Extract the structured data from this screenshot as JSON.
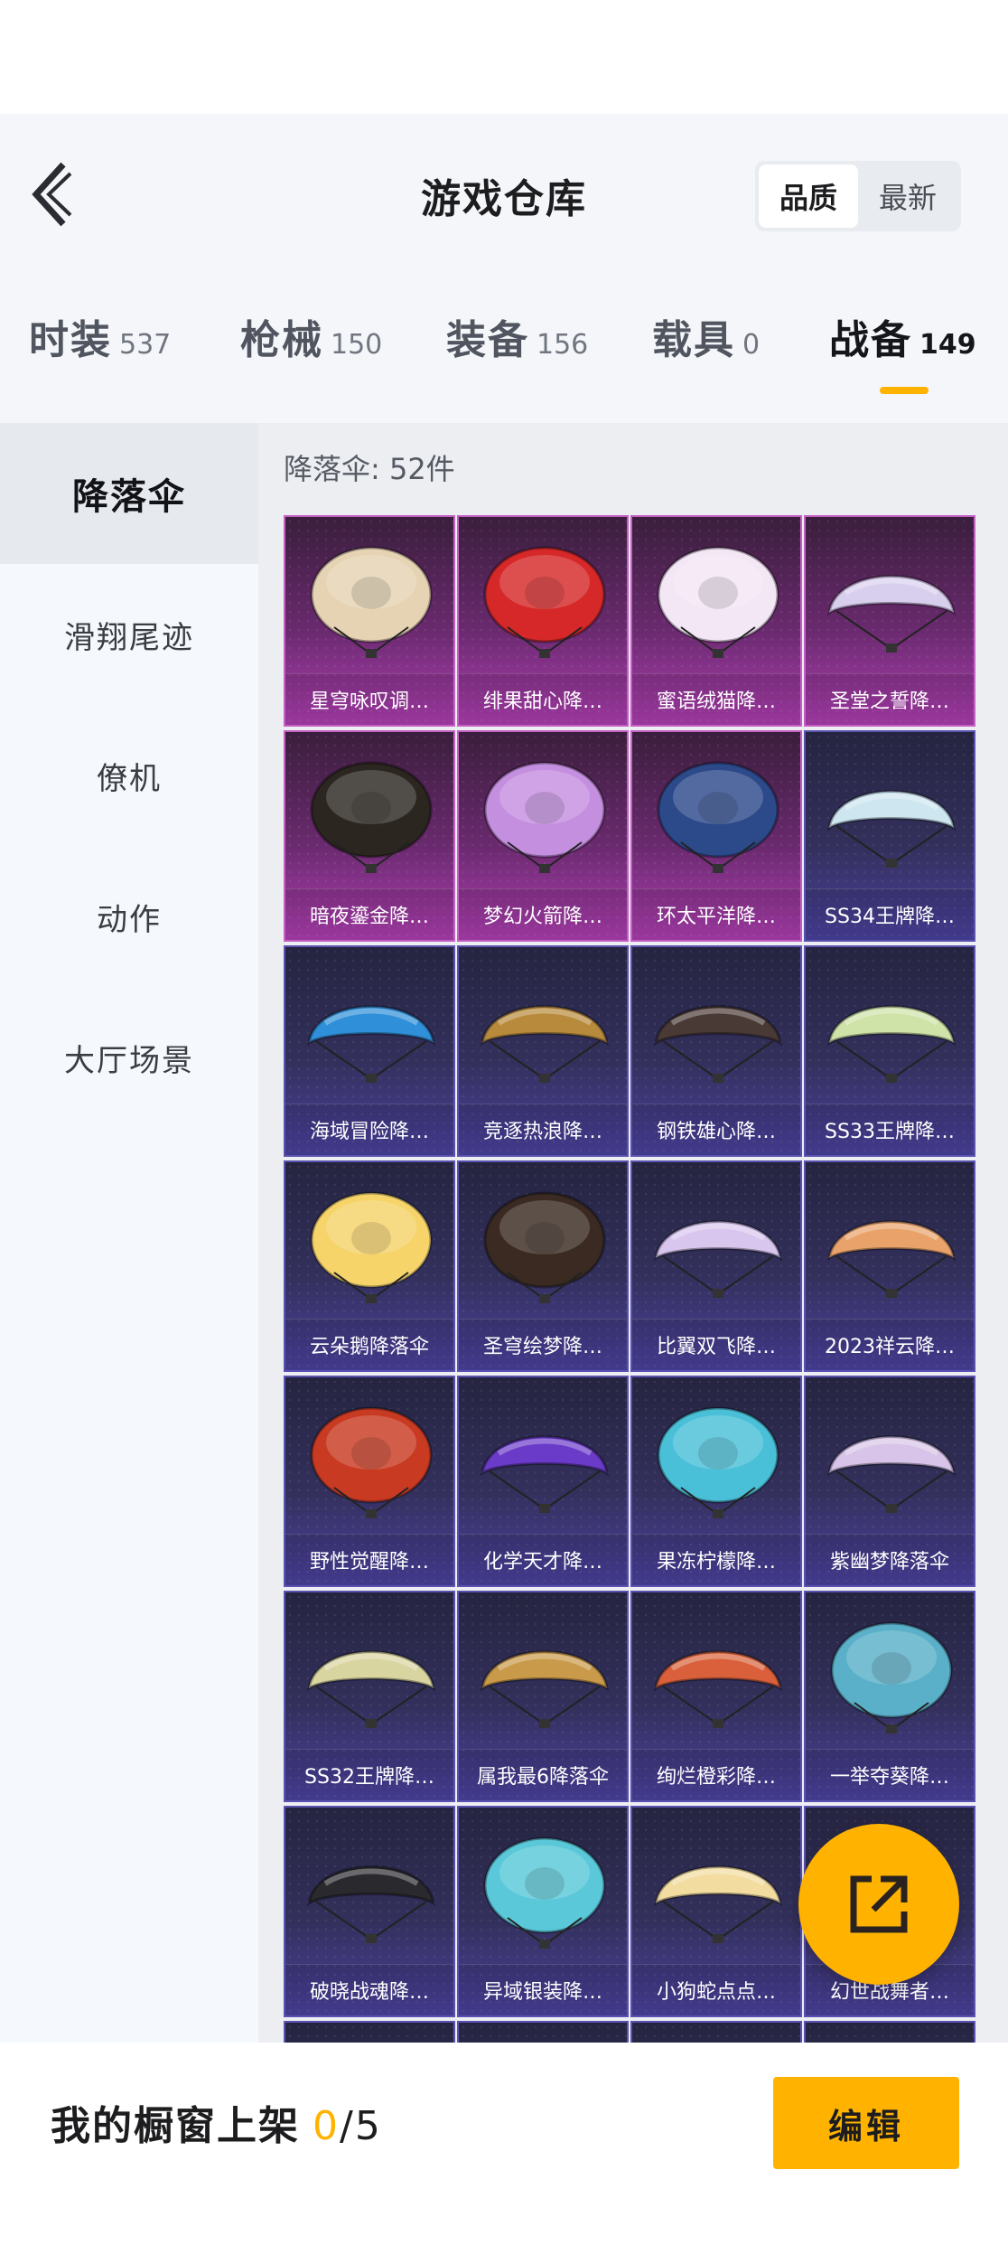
{
  "header": {
    "title": "游戏仓库",
    "sort": [
      {
        "label": "品质",
        "active": true
      },
      {
        "label": "最新",
        "active": false
      }
    ]
  },
  "tabs": [
    {
      "label": "时装",
      "count": "537"
    },
    {
      "label": "枪械",
      "count": "150"
    },
    {
      "label": "装备",
      "count": "156"
    },
    {
      "label": "载具",
      "count": "0"
    },
    {
      "label": "战备",
      "count": "149",
      "active": true
    }
  ],
  "sidebar": {
    "items": [
      {
        "label": "降落伞",
        "active": true
      },
      {
        "label": "滑翔尾迹"
      },
      {
        "label": "僚机"
      },
      {
        "label": "动作"
      },
      {
        "label": "大厅场景"
      }
    ]
  },
  "content": {
    "count_label": "降落伞: 52件",
    "items": [
      {
        "name": "星穹咏叹调…",
        "rarity": "purple",
        "color": "#e6d3b3",
        "shape": "round"
      },
      {
        "name": "绯果甜心降…",
        "rarity": "purple",
        "color": "#d62828",
        "shape": "round"
      },
      {
        "name": "蜜语绒猫降…",
        "rarity": "purple",
        "color": "#f3e6f5",
        "shape": "round"
      },
      {
        "name": "圣堂之誓降…",
        "rarity": "purple",
        "color": "#d8cfee",
        "shape": "wing"
      },
      {
        "name": "暗夜鎏金降…",
        "rarity": "purple",
        "color": "#2b2620",
        "shape": "round"
      },
      {
        "name": "梦幻火箭降…",
        "rarity": "purple",
        "color": "#c58fe0",
        "shape": "round"
      },
      {
        "name": "环太平洋降…",
        "rarity": "purple",
        "color": "#2c4a8a",
        "shape": "round"
      },
      {
        "name": "SS34王牌降…",
        "rarity": "blue",
        "color": "#cde6f0",
        "shape": "wing"
      },
      {
        "name": "海域冒险降…",
        "rarity": "blue",
        "color": "#2f8fd8",
        "shape": "wing"
      },
      {
        "name": "竞逐热浪降…",
        "rarity": "blue",
        "color": "#b88a3c",
        "shape": "wing"
      },
      {
        "name": "钢铁雄心降…",
        "rarity": "blue",
        "color": "#4a3a36",
        "shape": "wing"
      },
      {
        "name": "SS33王牌降…",
        "rarity": "blue",
        "color": "#cfe3a8",
        "shape": "wing"
      },
      {
        "name": "云朵鹅降落伞",
        "rarity": "blue",
        "color": "#f6d46a",
        "shape": "round"
      },
      {
        "name": "圣穹绘梦降…",
        "rarity": "blue",
        "color": "#3a2a22",
        "shape": "round"
      },
      {
        "name": "比翼双飞降…",
        "rarity": "blue",
        "color": "#d9c6ee",
        "shape": "wing"
      },
      {
        "name": "2023祥云降…",
        "rarity": "blue",
        "color": "#e9a36a",
        "shape": "wing"
      },
      {
        "name": "野性觉醒降…",
        "rarity": "blue",
        "color": "#c93a22",
        "shape": "round"
      },
      {
        "name": "化学天才降…",
        "rarity": "blue",
        "color": "#6a3ac9",
        "shape": "wing"
      },
      {
        "name": "果冻柠檬降…",
        "rarity": "blue",
        "color": "#4ac0d8",
        "shape": "round"
      },
      {
        "name": "紫幽梦降落伞",
        "rarity": "blue",
        "color": "#d8c4e8",
        "shape": "wing"
      },
      {
        "name": "SS32王牌降…",
        "rarity": "blue",
        "color": "#d9d5a0",
        "shape": "wing"
      },
      {
        "name": "属我最6降落伞",
        "rarity": "blue",
        "color": "#c99a4a",
        "shape": "wing"
      },
      {
        "name": "绚烂橙彩降…",
        "rarity": "blue",
        "color": "#d9603a",
        "shape": "wing"
      },
      {
        "name": "一举夺葵降…",
        "rarity": "blue",
        "color": "#5ab0c8",
        "shape": "round"
      },
      {
        "name": "破晓战魂降…",
        "rarity": "blue",
        "color": "#2a2a2e",
        "shape": "wing"
      },
      {
        "name": "异域银装降…",
        "rarity": "blue",
        "color": "#5ac8d8",
        "shape": "round"
      },
      {
        "name": "小狗蛇点点…",
        "rarity": "blue",
        "color": "#f2dca0",
        "shape": "wing"
      },
      {
        "name": "幻世战舞者…",
        "rarity": "blue",
        "color": "#b8a0d8",
        "shape": "wing"
      },
      {
        "name": "",
        "rarity": "blue",
        "color": "#33305c",
        "shape": "none"
      },
      {
        "name": "",
        "rarity": "blue",
        "color": "#33305c",
        "shape": "none"
      },
      {
        "name": "",
        "rarity": "blue",
        "color": "#33305c",
        "shape": "none"
      },
      {
        "name": "",
        "rarity": "blue",
        "color": "#33305c",
        "shape": "none"
      }
    ]
  },
  "bottom": {
    "showcase_label": "我的橱窗上架",
    "current": "0",
    "separator": "/",
    "total": "5",
    "edit_label": "编辑"
  },
  "icons": {
    "back": "chevron-left-icon",
    "share": "external-share-icon"
  },
  "colors": {
    "accent": "#ffb300",
    "purple_rarity": "#b03fb3",
    "blue_rarity": "#4c42a0"
  }
}
